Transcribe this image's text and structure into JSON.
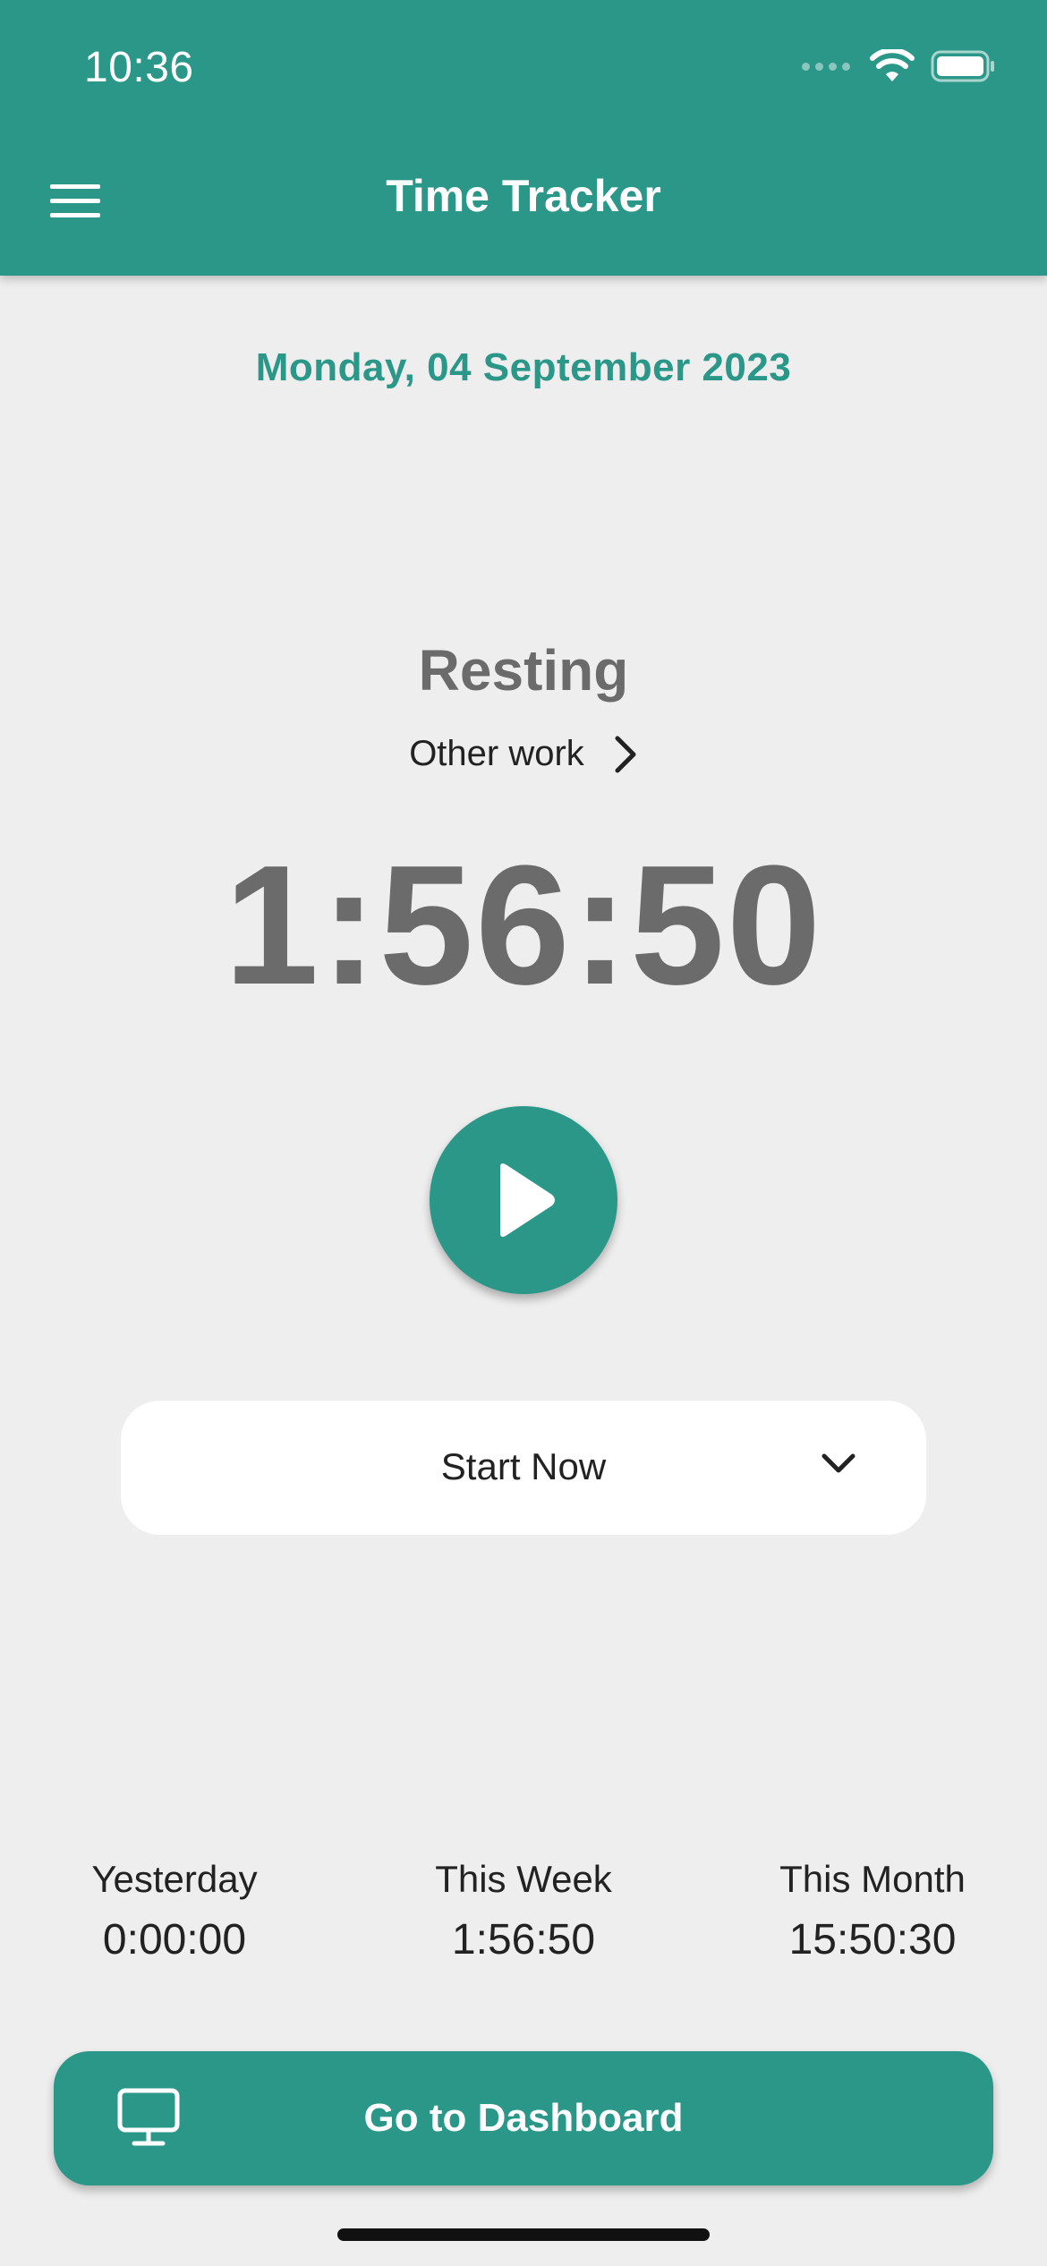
{
  "status_bar": {
    "time": "10:36",
    "icons": [
      "cellular-signal-icon",
      "wifi-icon",
      "battery-icon"
    ]
  },
  "header": {
    "title": "Time Tracker",
    "menu_icon": "hamburger-menu-icon"
  },
  "date": "Monday, 04 September 2023",
  "tracker": {
    "status": "Resting",
    "work_type": "Other work",
    "elapsed": "1:56:50",
    "play_icon": "play-icon"
  },
  "start_select": {
    "value": "Start Now",
    "icon": "chevron-down-icon"
  },
  "stats": [
    {
      "label": "Yesterday",
      "value": "0:00:00"
    },
    {
      "label": "This Week",
      "value": "1:56:50"
    },
    {
      "label": "This Month",
      "value": "15:50:30"
    }
  ],
  "dashboard_button": {
    "label": "Go to Dashboard",
    "icon": "monitor-icon"
  },
  "colors": {
    "primary": "#2a9788",
    "background": "#eeeeee",
    "timer_text": "#6b6b6b"
  }
}
